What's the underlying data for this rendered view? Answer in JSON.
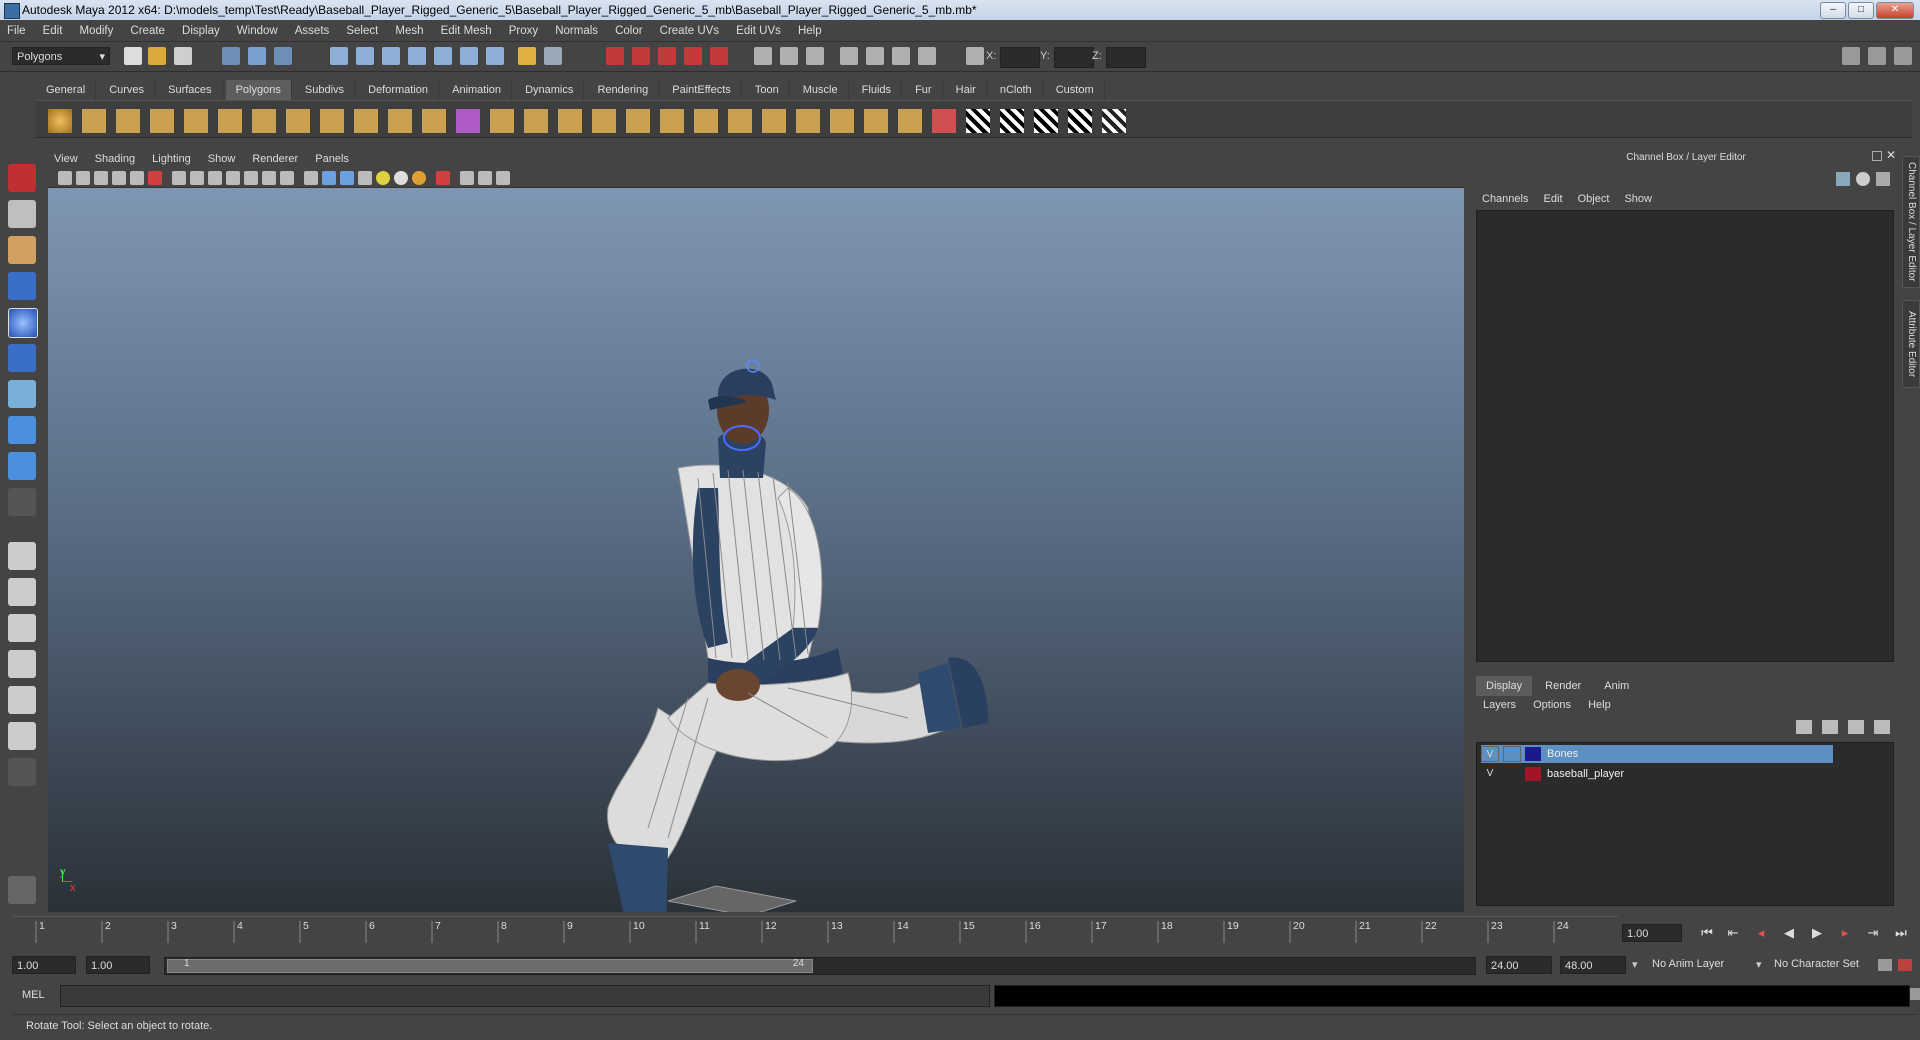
{
  "window": {
    "title": "Autodesk Maya 2012 x64: D:\\models_temp\\Test\\Ready\\Baseball_Player_Rigged_Generic_5\\Baseball_Player_Rigged_Generic_5_mb\\Baseball_Player_Rigged_Generic_5_mb.mb*",
    "minimize": "–",
    "maximize": "□",
    "close": "✕"
  },
  "menubar": [
    "File",
    "Edit",
    "Modify",
    "Create",
    "Display",
    "Window",
    "Assets",
    "Select",
    "Mesh",
    "Edit Mesh",
    "Proxy",
    "Normals",
    "Color",
    "Create UVs",
    "Edit UVs",
    "Help"
  ],
  "statusline": {
    "mode": "Polygons",
    "x_label": "X:",
    "y_label": "Y:",
    "z_label": "Z:"
  },
  "shelf": {
    "tabs": [
      "General",
      "Curves",
      "Surfaces",
      "Polygons",
      "Subdivs",
      "Deformation",
      "Animation",
      "Dynamics",
      "Rendering",
      "PaintEffects",
      "Toon",
      "Muscle",
      "Fluids",
      "Fur",
      "Hair",
      "nCloth",
      "Custom"
    ],
    "active_tab": "Polygons"
  },
  "viewport": {
    "menu": [
      "View",
      "Shading",
      "Lighting",
      "Show",
      "Renderer",
      "Panels"
    ],
    "axis_x": "x",
    "axis_y": "y"
  },
  "channel_box": {
    "title": "Channel Box / Layer Editor",
    "menu": [
      "Channels",
      "Edit",
      "Object",
      "Show"
    ]
  },
  "layer_editor": {
    "tabs": [
      "Display",
      "Render",
      "Anim"
    ],
    "active_tab": "Display",
    "menu": [
      "Layers",
      "Options",
      "Help"
    ],
    "layers": [
      {
        "visible": "V",
        "name": "Bones",
        "color": "#1a1a8c",
        "selected": true
      },
      {
        "visible": "V",
        "name": "baseball_player",
        "color": "#a01628",
        "selected": false
      }
    ]
  },
  "side_tabs": [
    "Channel Box / Layer Editor",
    "Attribute Editor"
  ],
  "timeslider": {
    "ticks": [
      "1",
      "2",
      "3",
      "4",
      "5",
      "6",
      "7",
      "8",
      "9",
      "10",
      "11",
      "12",
      "13",
      "14",
      "15",
      "16",
      "17",
      "18",
      "19",
      "20",
      "21",
      "22",
      "23",
      "24"
    ],
    "current_frame": "1.00"
  },
  "range": {
    "start": "1.00",
    "start_inner": "1.00",
    "slider_start": "1",
    "slider_end": "24",
    "end_inner": "24.00",
    "end": "48.00",
    "anim_layer": "No Anim Layer",
    "char_set": "No Character Set"
  },
  "cmdline": {
    "label": "MEL"
  },
  "helpline": "Rotate Tool: Select an object to rotate."
}
